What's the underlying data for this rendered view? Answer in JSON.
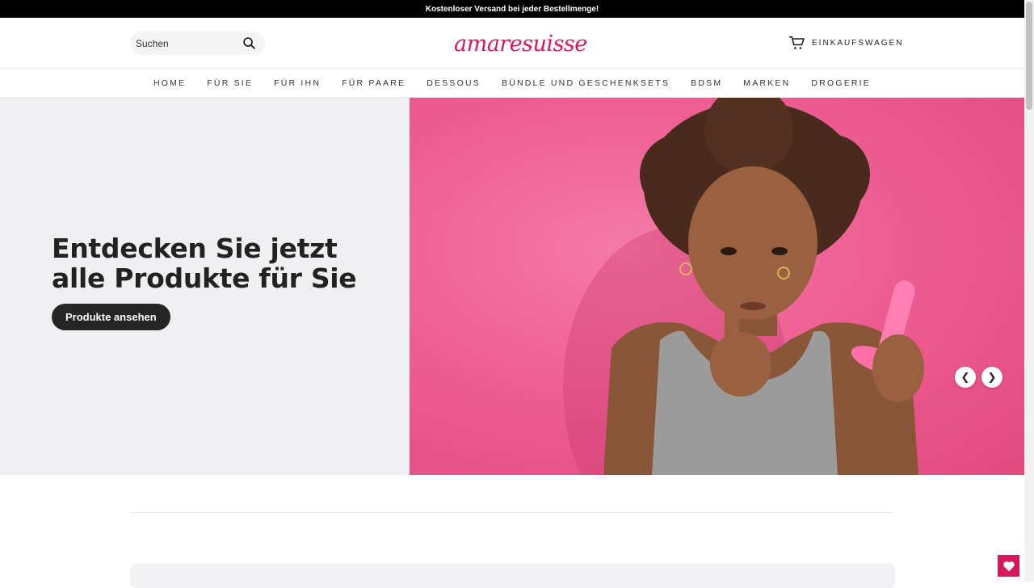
{
  "announcement": "Kostenloser Versand bei jeder Bestellmenge!",
  "header": {
    "search_placeholder": "Suchen",
    "logo_text": "amaresuisse",
    "cart_label": "EINKAUFSWAGEN"
  },
  "nav": {
    "items": [
      "HOME",
      "FÜR SIE",
      "FÜR IHN",
      "FÜR PAARE",
      "DESSOUS",
      "BÜNDLE UND GESCHENKSETS",
      "BDSM",
      "MARKEN",
      "DROGERIE"
    ]
  },
  "hero": {
    "title_line1": "Entdecken Sie jetzt",
    "title_line2": "alle Produkte für Sie",
    "button_label": "Produkte ansehen"
  },
  "colors": {
    "brand": "#d8185c",
    "hero_bg": "#ed5c91",
    "button": "#262626"
  }
}
